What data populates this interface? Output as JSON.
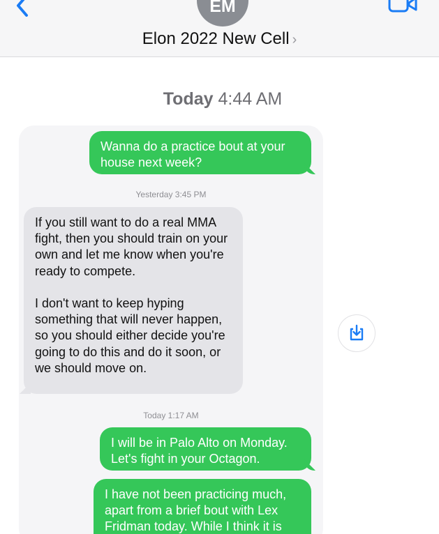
{
  "header": {
    "avatar_initials": "EM",
    "contact_name": "Elon 2022 New Cell",
    "chevron": "›",
    "back_icon": "chevron-left-icon",
    "video_icon": "video-camera-icon"
  },
  "thread": {
    "top_timestamp_day": "Today",
    "top_timestamp_time": "4:44 AM",
    "messages": [
      {
        "direction": "outgoing",
        "text": "Wanna do a practice bout at your house next week?"
      },
      {
        "timestamp": "Yesterday 3:45 PM"
      },
      {
        "direction": "incoming",
        "text": "If you still want to do a real MMA fight, then you should train on your own and let me know when you're ready to compete.\n\nI don't want to keep hyping something that will never happen, so you should either decide you're going to do this and do it soon, or we should move on."
      },
      {
        "timestamp": "Today 1:17 AM"
      },
      {
        "direction": "outgoing",
        "text": "I will be in Palo Alto on Monday. Let's fight in your Octagon."
      },
      {
        "direction": "outgoing",
        "text": "I have not been practicing much, apart from a brief bout with Lex Fridman today. While I think it is"
      }
    ]
  },
  "colors": {
    "outgoing_bubble": "#35c759",
    "incoming_bubble": "#e4e4e8",
    "accent_blue": "#1a7cf5"
  },
  "save_button": {
    "icon": "download-tray-icon"
  }
}
